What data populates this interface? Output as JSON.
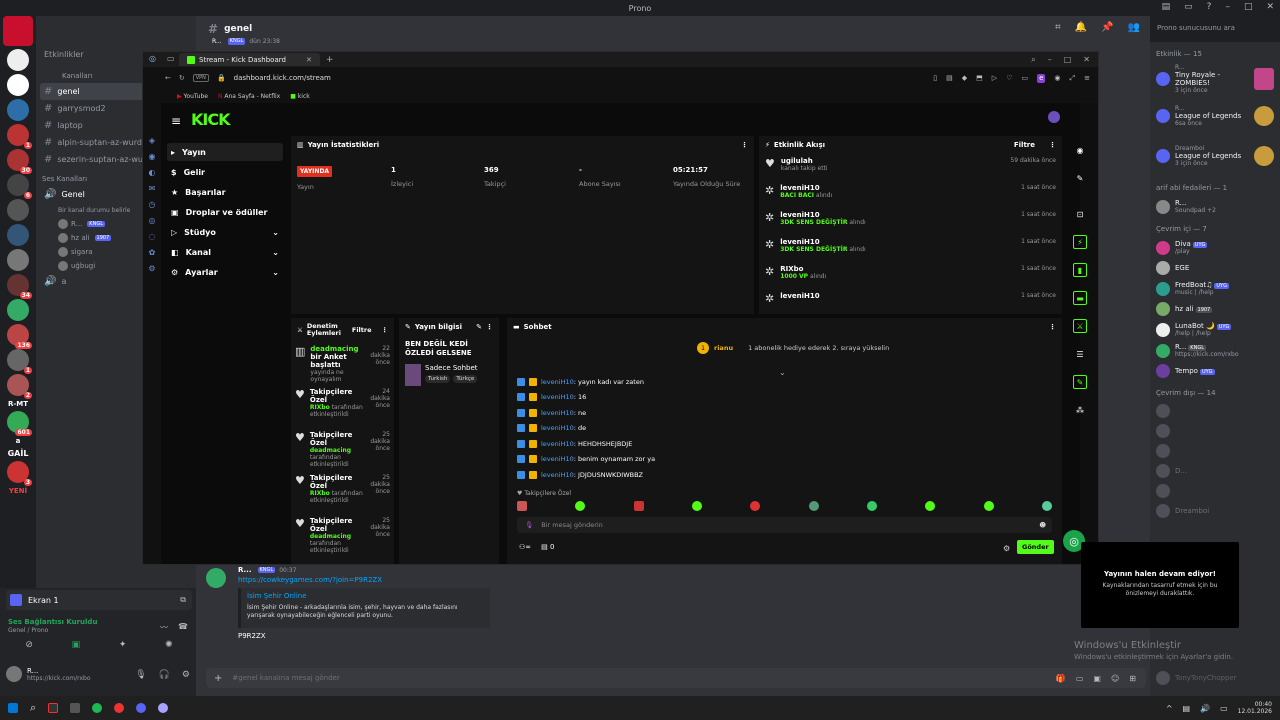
{
  "window": {
    "title": "Prono"
  },
  "discord": {
    "channel_header": "genel",
    "search_placeholder": "Prono sunucusunu ara",
    "channel_partial_top": "Etkinlikler",
    "category_text": "Kanalları",
    "text_channels": [
      "genel",
      "garrysmod2",
      "laptop",
      "alpin-suptan-az-wurd",
      "sezerin-suptan-az-wurd"
    ],
    "voice_category": "Ses Kanalları",
    "voice_channel": "Genel",
    "voice_status": "Bir kanal durumu belirle",
    "voice_users": [
      {
        "name": "R...",
        "tag": "KNGL"
      },
      {
        "name": "hz ali",
        "tag": "1907"
      },
      {
        "name": "sigara",
        "tag": ""
      },
      {
        "name": "uğbugi",
        "tag": ""
      }
    ],
    "voice_channel_2": "a",
    "rail_badges": [
      "1",
      "30",
      "6",
      "34",
      "136",
      "1",
      "2",
      "601",
      "3",
      "4"
    ],
    "rail_texts": [
      "a",
      "GAİL",
      "R-MT",
      "YENİ"
    ],
    "screen_share": {
      "title": "Ekran 1"
    },
    "voice_connected": "Ses Bağlantısı Kuruldu",
    "voice_connected_sub": "Genel / Prono",
    "self_user": {
      "name": "R...",
      "status": "https://kick.com/rxbo"
    },
    "message": {
      "author": "R...",
      "tag": "KNGL",
      "time": "00:37",
      "link": "https://cowkeygames.com/?join=P9R2ZX",
      "embed_title": "İsim Şehir Online",
      "embed_desc": "İsim Şehir Online - arkadaşlarınla isim, şehir, hayvan ve daha fazlasını yarışarak oynayabileceğin eğlenceli parti oyunu.",
      "body": "P9R2ZX"
    },
    "top_message": {
      "author": "R...",
      "tag": "KNGL",
      "time": "dün 23:38"
    },
    "input_placeholder": "#genel kanalına mesaj gönder",
    "members": {
      "activity_header": "Etkinlik — 15",
      "activities": [
        {
          "name": "R...",
          "game": "Tiny Royale - ZOMBIES!",
          "sub": "3 için önce"
        },
        {
          "name": "R...",
          "game": "League of Legends",
          "sub": "6sa önce"
        },
        {
          "name": "Dreamboi",
          "game": "League of Legends",
          "sub": "3 için önce"
        }
      ],
      "fedai_header": "arif abi fedaileri — 1",
      "fedai": [
        {
          "name": "R...",
          "sub": "Soundpad +2"
        }
      ],
      "online_header": "Çevrim içi — 7",
      "online": [
        {
          "name": "Diva",
          "tag": "UYG",
          "sub": "/play"
        },
        {
          "name": "EGE",
          "tag": "",
          "sub": ""
        },
        {
          "name": "FredBoat♫",
          "tag": "UYG",
          "sub": "music | /help"
        },
        {
          "name": "hz ali",
          "tag": "1907",
          "sub": ""
        },
        {
          "name": "LunaBot 🌙",
          "tag": "UYG",
          "sub": "/help | /help"
        },
        {
          "name": "R...",
          "tag": "KNGL",
          "sub": "https://kick.com/rxbo"
        },
        {
          "name": "Tempo",
          "tag": "UYG",
          "sub": ""
        }
      ],
      "offline_header": "Çevrim dışı — 14",
      "offline": [
        "",
        "",
        "",
        "D...",
        "",
        "Dreamboi",
        "",
        "",
        "",
        "",
        "",
        "TonyTonyChopper"
      ]
    }
  },
  "browser": {
    "tab_title": "Stream - Kick Dashboard",
    "url": "dashboard.kick.com/stream",
    "bookmarks": [
      "YouTube",
      "Ana Sayfa - Netflix",
      "kick"
    ]
  },
  "kick": {
    "logo": "KICK",
    "nav": [
      {
        "label": "Yayın",
        "icon": "▸",
        "chev": false
      },
      {
        "label": "Gelir",
        "icon": "$",
        "chev": false
      },
      {
        "label": "Başarılar",
        "icon": "★",
        "chev": false
      },
      {
        "label": "Droplar ve ödüller",
        "icon": "▣",
        "chev": false
      },
      {
        "label": "Stüdyo",
        "icon": "▷",
        "chev": true
      },
      {
        "label": "Kanal",
        "icon": "◧",
        "chev": true
      },
      {
        "label": "Ayarlar",
        "icon": "⚙",
        "chev": true
      }
    ],
    "stats": {
      "title": "Yayın İstatistikleri",
      "live": "YAYINDA",
      "live_label": "Yayın",
      "viewers": "1",
      "viewers_label": "İzleyici",
      "followers": "369",
      "followers_label": "Takipçi",
      "subs": "-",
      "subs_label": "Abone Sayısı",
      "uptime": "05:21:57",
      "uptime_label": "Yayında Olduğu Süre"
    },
    "activity": {
      "title": "Etkinlik Akışı",
      "filter": "Filtre",
      "items": [
        {
          "name": "ugilulah",
          "sub": "kanalı takip etti",
          "reward": "",
          "after": "",
          "time": "59 dakika önce"
        },
        {
          "name": "leveniH10",
          "sub": "",
          "reward": "BACI BACI",
          "after": " alındı",
          "time": "1 saat önce"
        },
        {
          "name": "leveniH10",
          "sub": "",
          "reward": "3DK SENS DEĞİŞTİR",
          "after": " alındı",
          "time": "1 saat önce"
        },
        {
          "name": "leveniH10",
          "sub": "",
          "reward": "3DK SENS DEĞİŞTİR",
          "after": " alındı",
          "time": "1 saat önce"
        },
        {
          "name": "RIXbo",
          "sub": "",
          "reward": "1000 VP",
          "after": " alındı",
          "time": "1 saat önce"
        },
        {
          "name": "leveniH10",
          "sub": "",
          "reward": "",
          "after": "",
          "time": "1 saat önce"
        }
      ]
    },
    "modlog": {
      "title": "Denetim Eylemleri",
      "filter": "Filtre",
      "items": [
        {
          "user": "deadmacing",
          "title": "bir Anket başlattı",
          "desc": "yayında ne oynayalım",
          "time": "22 dakika önce"
        },
        {
          "user": "RIXbo",
          "title": "Takipçilere Özel",
          "desc": "tarafından etkinleştirildi",
          "time": "24 dakika önce"
        },
        {
          "user": "deadmacing",
          "title": "Takipçilere Özel",
          "desc": "tarafından etkinleştirildi",
          "time": "25 dakika önce"
        },
        {
          "user": "RIXbo",
          "title": "Takipçilere Özel",
          "desc": "tarafından etkinleştirildi",
          "time": "25 dakika önce"
        },
        {
          "user": "deadmacing",
          "title": "Takipçilere Özel",
          "desc": "tarafından etkinleştirildi",
          "time": "25 dakika önce"
        }
      ]
    },
    "streaminfo": {
      "title": "Yayın bilgisi",
      "stream_title": "BEN DEĞİL KEDİ ÖZLEDİ GELSENE",
      "category": "Sadece Sohbet",
      "tags": [
        "Turkish",
        "Türkçe"
      ]
    },
    "chat": {
      "title": "Sohbet",
      "pinned_user": "rianu",
      "pinned_count": "1",
      "pinned_text": "1 abonelik hediye ederek 2. sıraya yükselin",
      "lines": [
        {
          "user": "leveniH10",
          "text": ": yayın kadı var zaten"
        },
        {
          "user": "leveniH10",
          "text": ": 16"
        },
        {
          "user": "leveniH10",
          "text": ": ne"
        },
        {
          "user": "leveniH10",
          "text": ": de"
        },
        {
          "user": "leveniH10",
          "text": ": HEHDHSHEJBDJE"
        },
        {
          "user": "leveniH10",
          "text": ": benim oynamam zor ya"
        },
        {
          "user": "leveniH10",
          "text": ": JDJDUSNWKDIWBBZ"
        }
      ],
      "followers_only": "Takipçilere Özel",
      "input_placeholder": "Bir mesaj gönderin",
      "points": "0",
      "send": "Gönder"
    }
  },
  "notification": {
    "title": "Yayının halen devam ediyor!",
    "body": "Kaynaklarından tasarruf etmek için bu önizlemeyi duraklattık."
  },
  "watermark": {
    "title": "Windows'u Etkinleştir",
    "body": "Windows'u etkinleştirmek için Ayarlar'a gidin."
  },
  "clock": {
    "time": "00:40",
    "date": "12.01.2026"
  }
}
